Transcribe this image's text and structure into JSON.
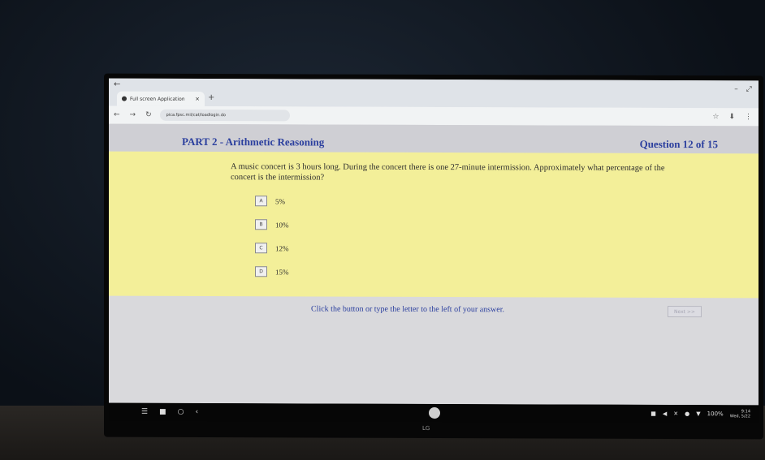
{
  "browser": {
    "tab_title": "Full screen Application",
    "tab_close": "×",
    "new_tab": "+",
    "back_arrow": "←",
    "minimize": "–",
    "maximize": "⤢",
    "nav": [
      "←",
      "→",
      "↻"
    ],
    "url": "pica.fpsc.mil/cat/loadlogin.do",
    "toolbar_right": [
      "☆",
      "⬇",
      "⋮"
    ]
  },
  "header": {
    "part_title": "PART 2 - Arithmetic Reasoning",
    "question_counter": "Question 12 of 15"
  },
  "question": {
    "text": "A music concert is 3 hours long. During the concert there is one 27-minute intermission. Approximately what percentage of the concert is the intermission?",
    "options": [
      {
        "key": "A",
        "label": "5%"
      },
      {
        "key": "B",
        "label": "10%"
      },
      {
        "key": "C",
        "label": "12%"
      },
      {
        "key": "D",
        "label": "15%"
      }
    ]
  },
  "footer": {
    "hint": "Click the button or type the letter to the left of your answer.",
    "next_label": "Next >>"
  },
  "shelf": {
    "left_icons": [
      "☰",
      "■",
      "○",
      "‹"
    ],
    "tray_icons": [
      "■",
      "◀",
      "✕",
      "●",
      "▼"
    ],
    "battery": "100%",
    "time": "9:14",
    "date": "Wed, 5/22"
  },
  "monitor": {
    "brand": "LG"
  }
}
